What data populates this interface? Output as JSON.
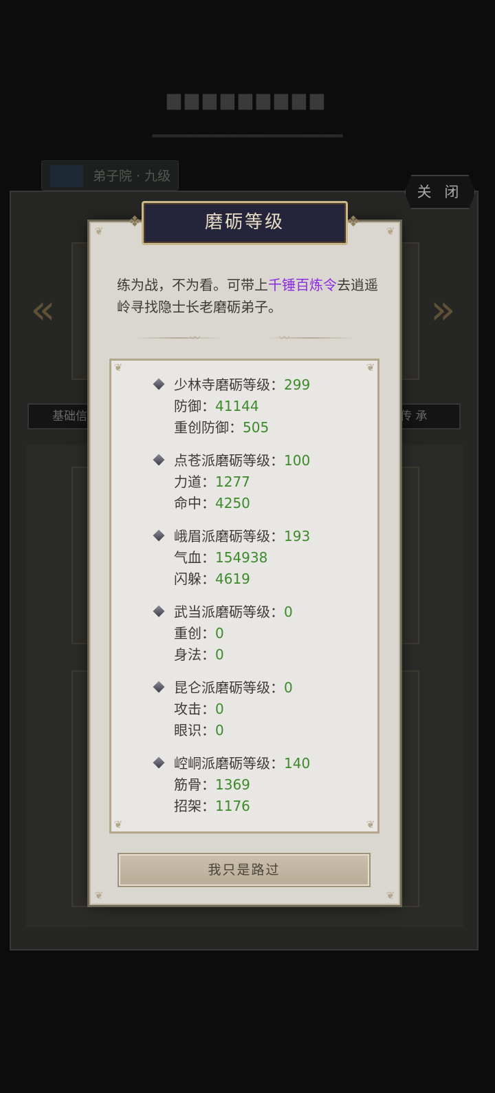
{
  "background": {
    "badge_text": "弟子院 · 九级",
    "close_label": "关 闭",
    "tab_left": "基础信",
    "tab_right": "传 承"
  },
  "modal": {
    "title": "磨砺等级",
    "intro_part1": "练为战，不为看。可带上",
    "intro_highlight": "千锤百炼令",
    "intro_part2": "去逍遥岭寻找隐士长老磨砺弟子。",
    "highlight_color": "#8a2be2",
    "value_color": "#3c8a2a",
    "groups": [
      {
        "head_label": "少林寺磨砺等级：",
        "head_value": "299",
        "stat1_label": "防御：",
        "stat1_value": "41144",
        "stat2_label": "重创防御：",
        "stat2_value": "505"
      },
      {
        "head_label": "点苍派磨砺等级：",
        "head_value": "100",
        "stat1_label": "力道：",
        "stat1_value": "1277",
        "stat2_label": "命中：",
        "stat2_value": "4250"
      },
      {
        "head_label": "峨眉派磨砺等级：",
        "head_value": "193",
        "stat1_label": "气血：",
        "stat1_value": "154938",
        "stat2_label": "闪躲：",
        "stat2_value": "4619"
      },
      {
        "head_label": "武当派磨砺等级：",
        "head_value": "0",
        "stat1_label": "重创：",
        "stat1_value": "0",
        "stat2_label": "身法：",
        "stat2_value": "0"
      },
      {
        "head_label": "昆仑派磨砺等级：",
        "head_value": "0",
        "stat1_label": "攻击：",
        "stat1_value": "0",
        "stat2_label": "眼识：",
        "stat2_value": "0"
      },
      {
        "head_label": "崆峒派磨砺等级：",
        "head_value": "140",
        "stat1_label": "筋骨：",
        "stat1_value": "1369",
        "stat2_label": "招架：",
        "stat2_value": "1176"
      }
    ],
    "button_label": "我只是路过"
  }
}
